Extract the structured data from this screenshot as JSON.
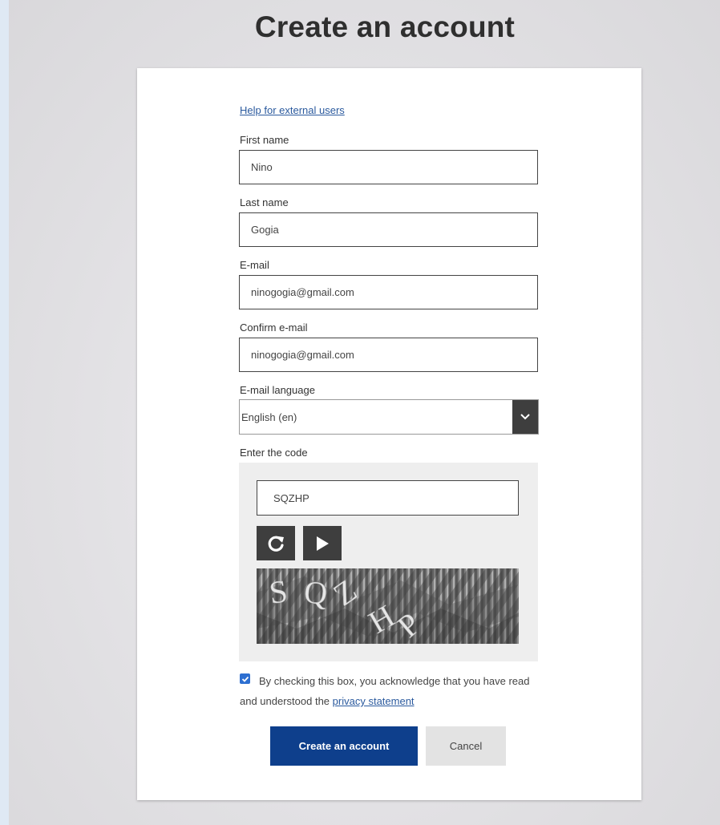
{
  "page": {
    "title": "Create an account"
  },
  "form": {
    "help_link": "Help for external users",
    "first_name": {
      "label": "First name",
      "value": "Nino"
    },
    "last_name": {
      "label": "Last name",
      "value": "Gogia"
    },
    "email": {
      "label": "E-mail",
      "value": "ninogogia@gmail.com"
    },
    "confirm_email": {
      "label": "Confirm e-mail",
      "value": "ninogogia@gmail.com"
    },
    "email_language": {
      "label": "E-mail language",
      "selected": "English (en)"
    },
    "captcha": {
      "label": "Enter the code",
      "value": "SQZHP",
      "image_text": "SQZHP"
    },
    "consent": {
      "checked": true,
      "text": "By checking this box, you acknowledge that you have read and understood the",
      "link": "privacy statement"
    },
    "submit_label": "Create an account",
    "cancel_label": "Cancel"
  },
  "colors": {
    "primary_button": "#0e3f8c",
    "link": "#2b5a9e",
    "dark_control": "#3e3e3e",
    "checkbox": "#2d6fd1"
  },
  "icons": {
    "select_toggle": "chevron-down-icon",
    "captcha_refresh": "refresh-icon",
    "captcha_audio": "play-icon"
  }
}
